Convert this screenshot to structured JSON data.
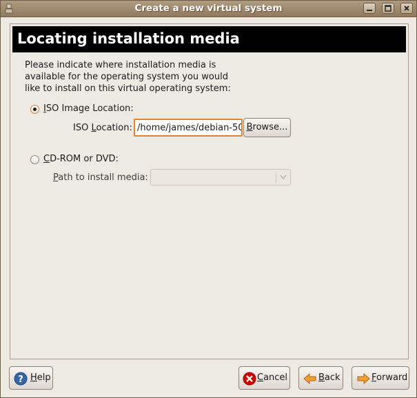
{
  "window": {
    "title": "Create a new virtual system"
  },
  "page": {
    "heading": "Locating installation media",
    "description_lines": [
      "Please indicate where installation media is",
      "available for the operating system you would",
      "like to install on this virtual operating system:"
    ]
  },
  "iso_option": {
    "radio_label_mnemonic": "I",
    "radio_label_rest": "SO Image Location:",
    "selected": true,
    "location_label_pre": "ISO ",
    "location_label_mnemonic": "L",
    "location_label_rest": "ocation:",
    "location_value": "/home/james/debian-50",
    "browse_mnemonic": "B",
    "browse_rest": "rowse..."
  },
  "cd_option": {
    "radio_label_mnemonic": "C",
    "radio_label_rest": "D-ROM or DVD:",
    "selected": false,
    "path_label_mnemonic": "P",
    "path_label_rest": "ath to install media:",
    "path_value": ""
  },
  "buttons": {
    "help_mnemonic": "H",
    "help_rest": "elp",
    "cancel_mnemonic": "C",
    "cancel_rest": "ancel",
    "back_mnemonic": "B",
    "back_rest": "ack",
    "forward_mnemonic": "F",
    "forward_rest": "orward"
  },
  "icons": {
    "app": "app-icon",
    "minimize": "minimize-icon",
    "maximize": "maximize-icon",
    "close": "close-icon",
    "help": "help-icon",
    "cancel": "cancel-icon",
    "back": "back-arrow-icon",
    "forward": "forward-arrow-icon",
    "combo": "chevron-down-icon"
  },
  "colors": {
    "titlebar": "#a08a6e",
    "focus_accent": "#e5822e",
    "header_band": "#000000",
    "background": "#ede9e3"
  }
}
